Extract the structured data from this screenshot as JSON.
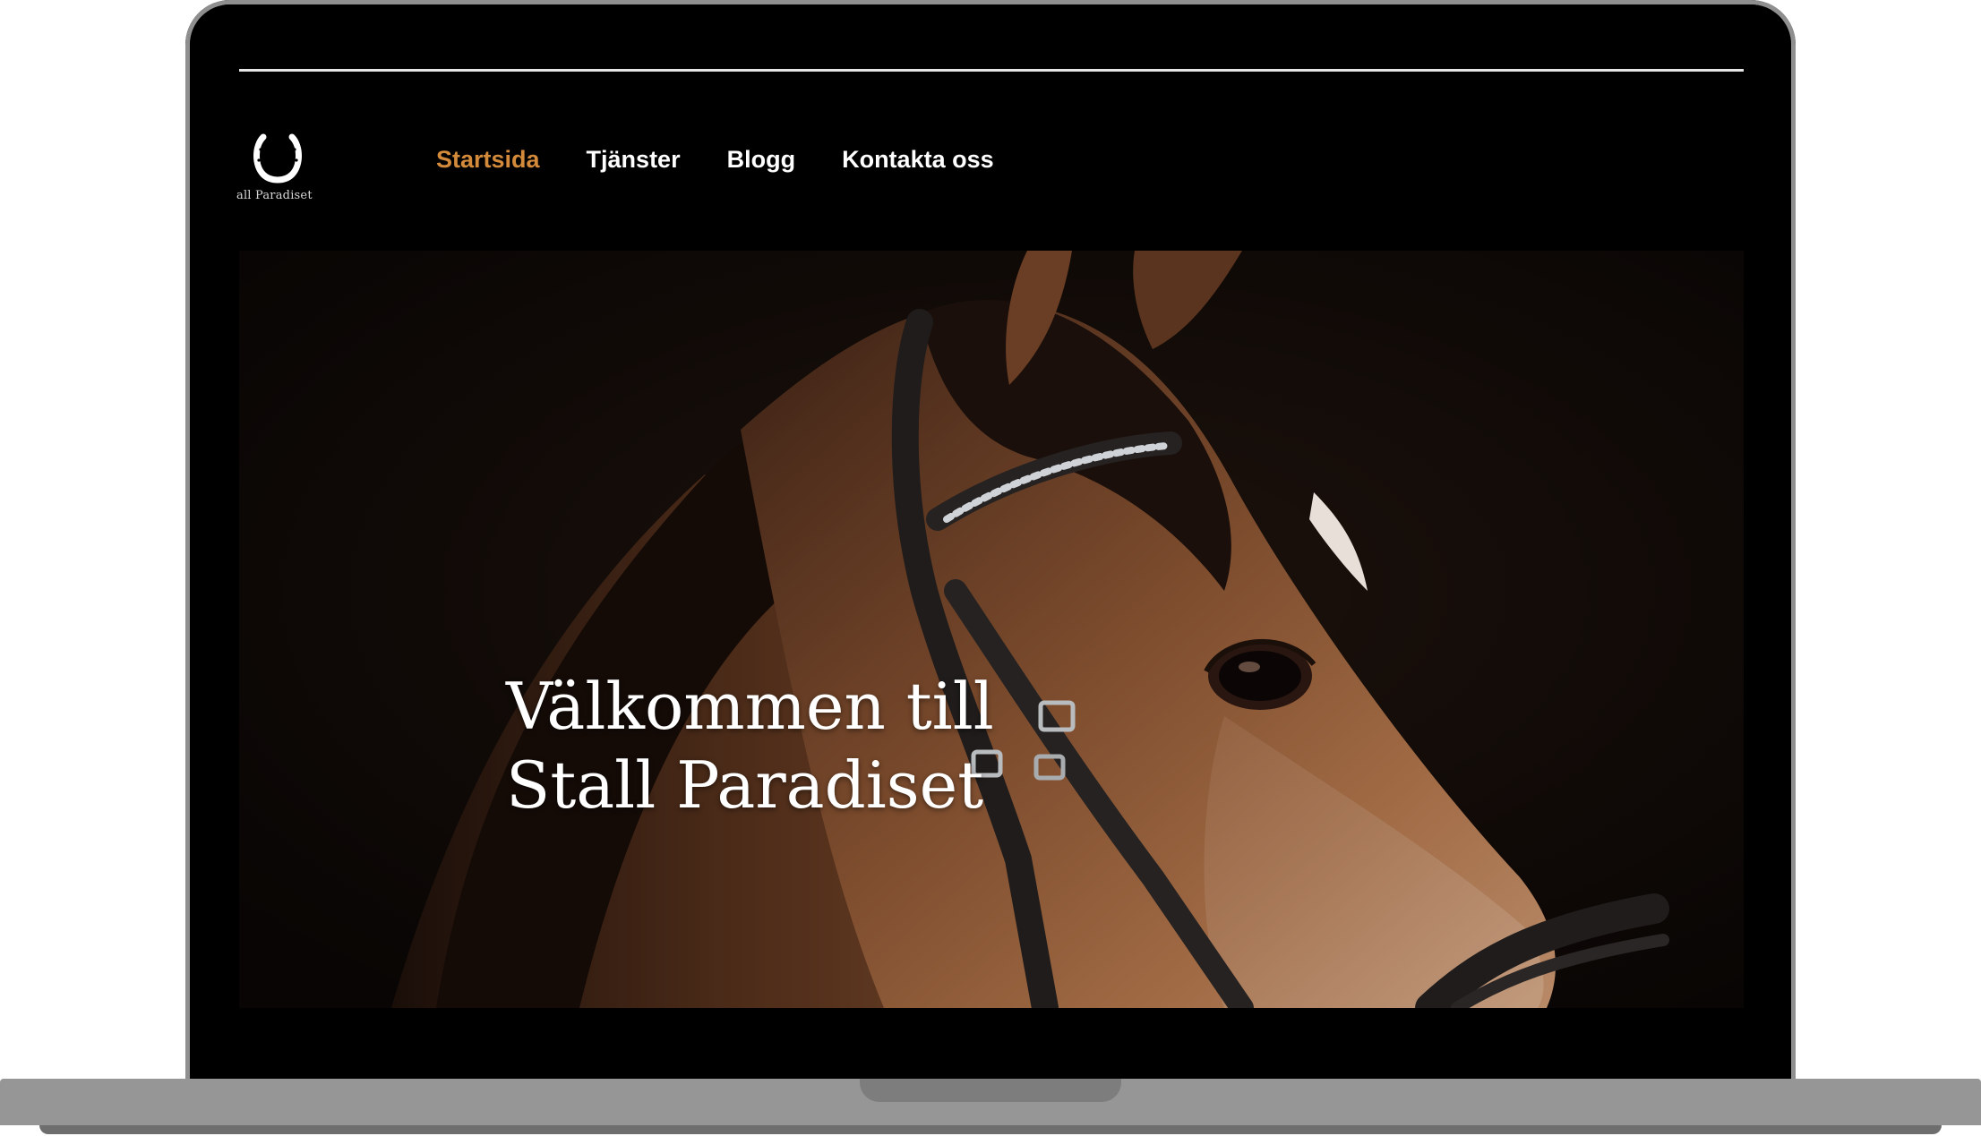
{
  "site": {
    "logo_text": "all Paradiset",
    "logo_icon": "horseshoe-icon"
  },
  "nav": {
    "items": [
      {
        "label": "Startsida",
        "active": true
      },
      {
        "label": "Tjänster",
        "active": false
      },
      {
        "label": "Blogg",
        "active": false
      },
      {
        "label": "Kontakta oss",
        "active": false
      }
    ]
  },
  "hero": {
    "title_line1": "Välkommen till",
    "title_line2": "Stall Paradiset",
    "image": "horse-head-photo"
  },
  "colors": {
    "accent": "#d38a3a",
    "background": "#000000",
    "text": "#ffffff",
    "frame": "#969696"
  }
}
